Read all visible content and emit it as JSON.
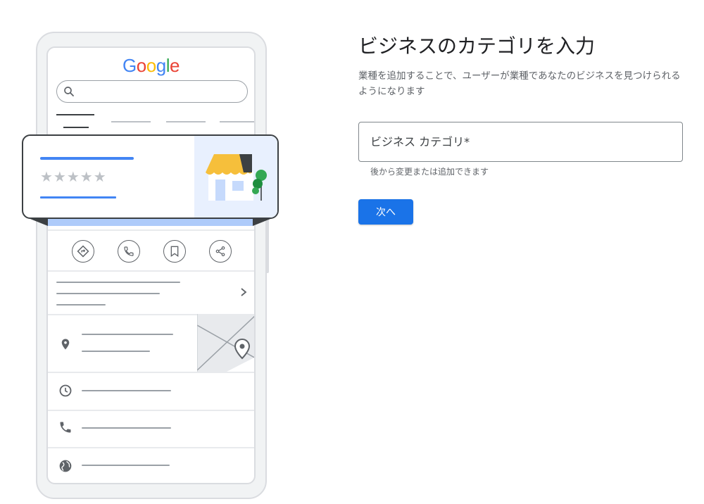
{
  "illustration": {
    "logo": {
      "g1": "G",
      "o1": "o",
      "o2": "o",
      "g2": "g",
      "l": "l",
      "e": "e"
    },
    "rating": "★★★★★",
    "icons": [
      "search-icon",
      "directions-icon",
      "phone-icon",
      "bookmark-icon",
      "share-icon",
      "chevron-right-icon",
      "location-pin-icon",
      "clock-icon",
      "globe-icon",
      "storefront-icon"
    ],
    "colors": {
      "google_blue": "#4285f4",
      "google_red": "#ea4335",
      "google_yellow": "#fbbc05",
      "google_green": "#34a853",
      "awning": "#f6bf3b",
      "card_accent": "#aecbfa"
    }
  },
  "form": {
    "title": "ビジネスのカテゴリを入力",
    "description": "業種を追加することで、ユーザーが業種であなたのビジネスを見つけられるようになります",
    "category_placeholder": "ビジネス カテゴリ*",
    "helper_text": "後から変更または追加できます",
    "next_label": "次へ",
    "accent_color": "#1a73e8"
  }
}
